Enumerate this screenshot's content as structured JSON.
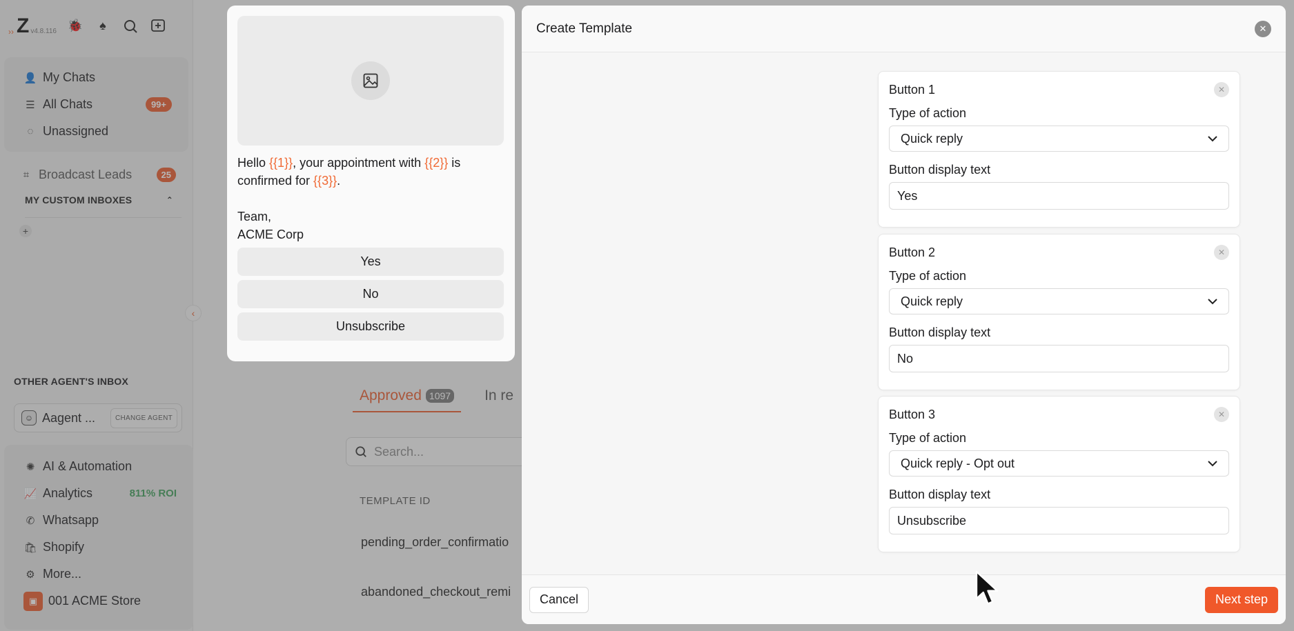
{
  "app": {
    "version": "v4.8.116",
    "nav": {
      "my_chats": "My Chats",
      "all_chats": "All Chats",
      "all_chats_badge": "99+",
      "unassigned": "Unassigned",
      "broadcast_leads": "Broadcast Leads",
      "broadcast_badge": "25",
      "custom_inboxes_heading": "MY CUSTOM INBOXES",
      "other_agent_heading": "OTHER AGENT'S INBOX",
      "agent_name": "Aagent ...",
      "change_agent": "CHANGE AGENT",
      "ai_automation": "AI & Automation",
      "analytics": "Analytics",
      "analytics_roi": "811% ROI",
      "whatsapp": "Whatsapp",
      "shopify": "Shopify",
      "more": "More...",
      "store": "001 ACME Store"
    },
    "templates": {
      "tab_approved": "Approved",
      "tab_approved_count": "1097",
      "tab_in_review": "In re",
      "search_placeholder": "Search...",
      "col_template_id": "TEMPLATE ID",
      "rows": [
        "pending_order_confirmatio",
        "abandoned_checkout_remi"
      ]
    }
  },
  "preview": {
    "msg_hello": "Hello ",
    "var1": "{{1}}",
    "msg_part2": ", your appointment with ",
    "var2": "{{2}}",
    "msg_part3": " is confirmed for ",
    "var3": "{{3}}",
    "msg_end": ".",
    "signature_line1": "Team,",
    "signature_line2": "ACME Corp",
    "buttons": [
      "Yes",
      "No",
      "Unsubscribe"
    ]
  },
  "modal": {
    "title": "Create Template",
    "buttons": [
      {
        "title": "Button 1",
        "type_label": "Type of action",
        "type_value": "Quick reply",
        "text_label": "Button display text",
        "text_value": "Yes"
      },
      {
        "title": "Button 2",
        "type_label": "Type of action",
        "type_value": "Quick reply",
        "text_label": "Button display text",
        "text_value": "No"
      },
      {
        "title": "Button 3",
        "type_label": "Type of action",
        "type_value": "Quick reply - Opt out",
        "text_label": "Button display text",
        "text_value": "Unsubscribe"
      }
    ],
    "cancel": "Cancel",
    "next": "Next step"
  },
  "colors": {
    "accent": "#f0582a",
    "variable": "#f06a35",
    "roi": "#3f9e5a"
  }
}
